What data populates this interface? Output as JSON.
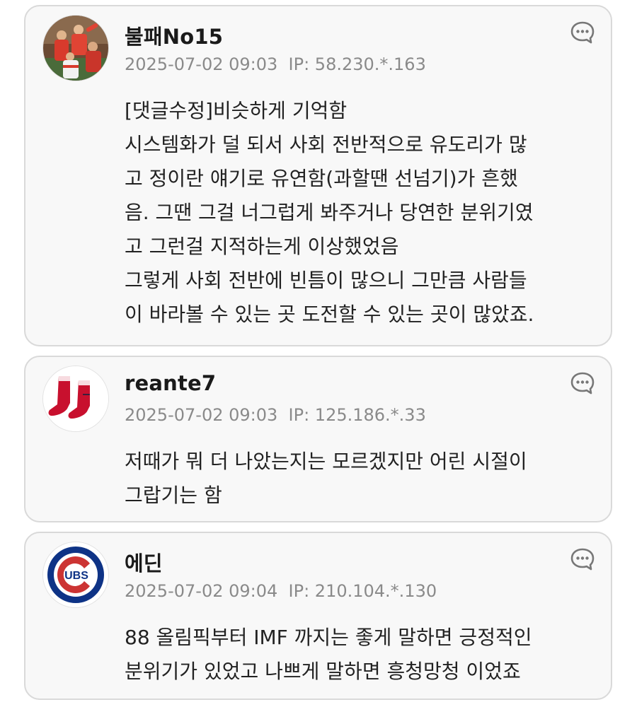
{
  "comments": [
    {
      "username": "불패No15",
      "meta": "2025-07-02 09:03  IP: 58.230.*.163",
      "avatar_icon": "baseball-team-photo-avatar",
      "reply_icon": "chat-bubble-icon",
      "lines": [
        "[댓글수정]비슷하게 기억함",
        "시스템화가 덜 되서 사회 전반적으로 유도리가 많",
        "고 정이란 얘기로 유연함(과할땐 선넘기)가 흔했",
        "음. 그땐 그걸 너그럽게 봐주거나 당연한 분위기였",
        "고 그런걸 지적하는게 이상했었음",
        "그렇게 사회 전반에 빈틈이 많으니 그만큼 사람들",
        "이 바라볼 수 있는 곳 도전할 수 있는 곳이 많았죠."
      ]
    },
    {
      "username": "reante7",
      "meta": "2025-07-02 09:03  IP: 125.186.*.33",
      "avatar_icon": "red-sox-logo-avatar",
      "reply_icon": "chat-bubble-icon",
      "lines": [
        "저때가 뭐 더 나았는지는 모르겠지만 어린 시절이",
        "그랍기는 함"
      ]
    },
    {
      "username": "에딘",
      "meta": "2025-07-02 09:04  IP: 210.104.*.130",
      "avatar_icon": "cubs-logo-avatar",
      "reply_icon": "chat-bubble-icon",
      "lines": [
        "88 올림픽부터 IMF 까지는 좋게 말하면 긍정적인",
        "분위기가 있었고 나쁘게 말하면 흥청망청 이었죠"
      ]
    }
  ],
  "colors": {
    "card_background": "#f8f8f8",
    "card_border": "#d9d9d9",
    "username": "#1a1a1a",
    "meta": "#8a8a8a",
    "body_text": "#222222",
    "red_sox_red": "#c8102e",
    "cubs_blue": "#0e3386",
    "cubs_red": "#cc3433"
  },
  "cubs_logo_text": "UBS"
}
